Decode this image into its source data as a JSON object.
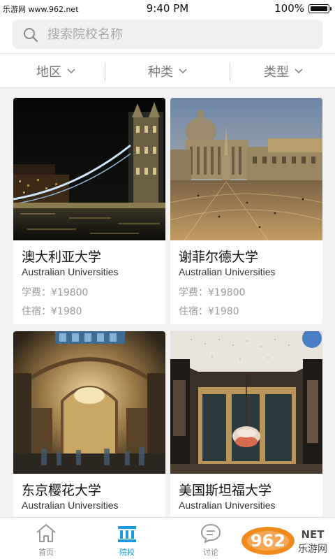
{
  "status": {
    "carrier": "乐游网 www.962.net",
    "time": "9:40 PM",
    "battery": "100%"
  },
  "search": {
    "placeholder": "搜索院校名称"
  },
  "filters": [
    {
      "label": "地区"
    },
    {
      "label": "种类"
    },
    {
      "label": "类型"
    }
  ],
  "universities": [
    {
      "name": "澳大利亚大学",
      "subtitle": "Australian Universities",
      "tuition_label": "学费：",
      "tuition": "¥19800",
      "board_label": "住宿：",
      "board": "¥1980"
    },
    {
      "name": "谢菲尔德大学",
      "subtitle": "Australian Universities",
      "tuition_label": "学费：",
      "tuition": "¥19800",
      "board_label": "住宿：",
      "board": "¥1980"
    },
    {
      "name": "东京樱花大学",
      "subtitle": "Australian Universities"
    },
    {
      "name": "美国斯坦福大学",
      "subtitle": "Australian Universities"
    }
  ],
  "tabs": [
    {
      "label": "首页",
      "active": false
    },
    {
      "label": "院校",
      "active": true
    },
    {
      "label": "讨论",
      "active": false
    }
  ],
  "watermark": {
    "text": "962",
    "suffix": "NET",
    "sub": "乐游网"
  },
  "colors": {
    "accent": "#1a9be0",
    "watermark": "#f08a1c"
  }
}
